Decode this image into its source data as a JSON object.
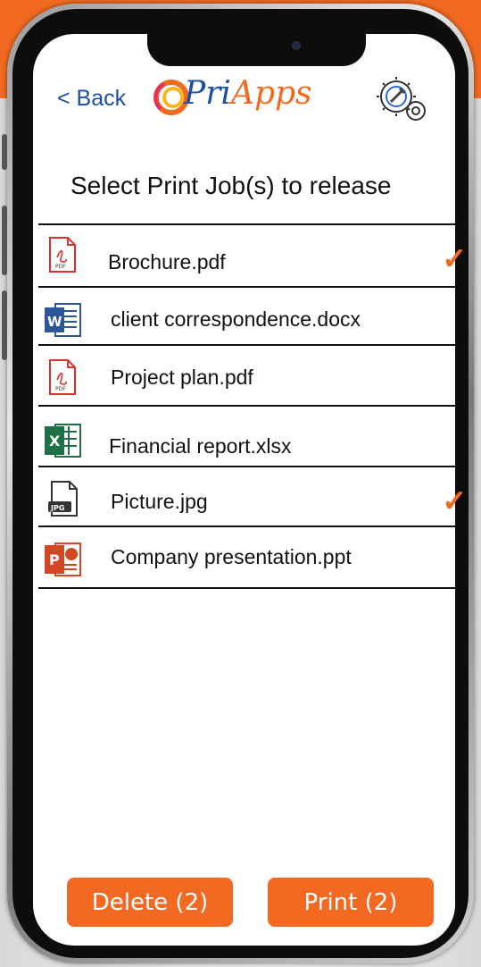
{
  "header": {
    "back_label": "< Back",
    "logo_text": "PriApps",
    "settings_icon": "gear-wrench-icon"
  },
  "page_title": "Select Print Job(s) to release",
  "jobs": [
    {
      "name": "Brochure.pdf",
      "icon": "pdf-icon",
      "selected": true
    },
    {
      "name": "client correspondence.docx",
      "icon": "word-icon",
      "selected": false
    },
    {
      "name": "Project plan.pdf",
      "icon": "pdf-icon",
      "selected": false
    },
    {
      "name": "Financial report.xlsx",
      "icon": "excel-icon",
      "selected": false
    },
    {
      "name": "Picture.jpg",
      "icon": "jpg-icon",
      "selected": true
    },
    {
      "name": "Company presentation.ppt",
      "icon": "powerpoint-icon",
      "selected": false
    }
  ],
  "check_mark": "✓",
  "actions": {
    "delete_label": "Delete (2)",
    "print_label": "Print (2)"
  },
  "colors": {
    "accent": "#f26a21",
    "link": "#1a4fa3",
    "word": "#2b5797",
    "excel": "#1e7145",
    "powerpoint": "#d24726"
  }
}
